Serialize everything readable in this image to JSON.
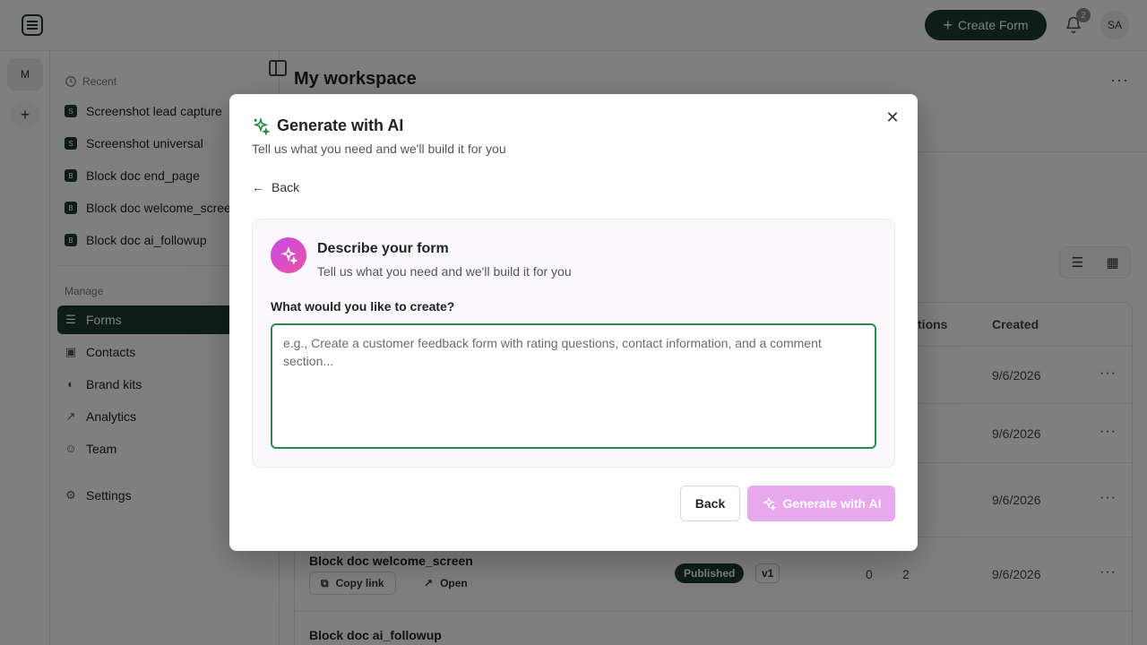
{
  "topbar": {
    "create_form_label": "Create Form",
    "notifications_count": "2",
    "avatar_initials": "SA"
  },
  "rail": {
    "workspace_initial": "M",
    "add_label": "+"
  },
  "sidebar": {
    "recent_heading": "Recent",
    "recent_items": [
      {
        "chip": "S",
        "label": "Screenshot lead capture"
      },
      {
        "chip": "S",
        "label": "Screenshot universal"
      },
      {
        "chip": "B",
        "label": "Block doc end_page"
      },
      {
        "chip": "B",
        "label": "Block doc welcome_screen"
      },
      {
        "chip": "B",
        "label": "Block doc ai_followup"
      }
    ],
    "manage_heading": "Manage",
    "nav": [
      {
        "label": "Forms",
        "icon": "list-icon",
        "active": true
      },
      {
        "label": "Contacts",
        "icon": "contacts-icon"
      },
      {
        "label": "Brand kits",
        "icon": "palette-icon"
      },
      {
        "label": "Analytics",
        "icon": "trend-icon"
      },
      {
        "label": "Team",
        "icon": "team-icon"
      }
    ],
    "settings_label": "Settings"
  },
  "main": {
    "title": "My workspace",
    "columns": {
      "questions": "Questions",
      "created": "Created"
    },
    "rows": [
      {
        "created": "9/6/2026"
      },
      {
        "created": "9/6/2026"
      },
      {
        "created": "9/6/2026"
      },
      {
        "name": "Block doc welcome_screen",
        "copy": "Copy link",
        "open": "Open",
        "status": "Published",
        "version": "v1",
        "responses": "0",
        "questions": "2",
        "created": "9/6/2026"
      },
      {
        "name": "Block doc ai_followup"
      }
    ]
  },
  "modal": {
    "title": "Generate with AI",
    "subtitle": "Tell us what you need and we'll build it for you",
    "back_link": "Back",
    "card": {
      "title": "Describe your form",
      "subtitle": "Tell us what you need and we'll build it for you",
      "field_label": "What would you like to create?",
      "placeholder": "e.g., Create a customer feedback form with rating questions, contact information, and a comment section...",
      "value": ""
    },
    "back_button": "Back",
    "generate_button": "Generate with AI"
  },
  "colors": {
    "brand": "#1e3b30",
    "focus_green": "#2e8a4a",
    "ai_pink": "#e8a8ec"
  }
}
